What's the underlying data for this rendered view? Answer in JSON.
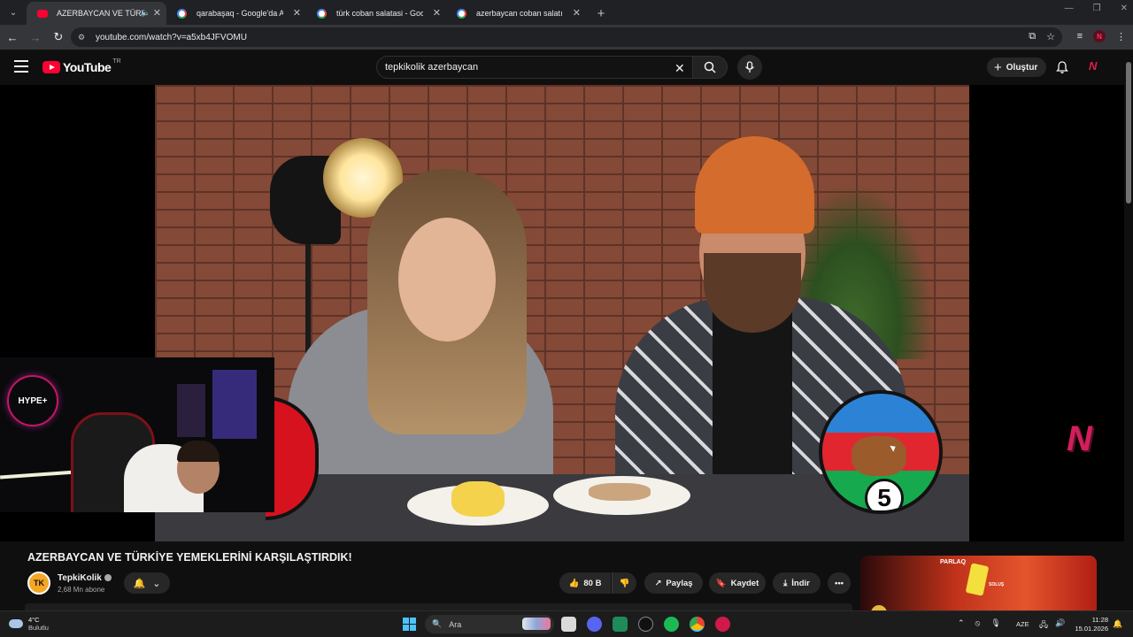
{
  "browser": {
    "tabs": [
      {
        "title": "AZERBAYCAN VE TÜRKİYE Y",
        "favicon": "youtube-icon",
        "active": true,
        "muted_icon": "speaker-icon"
      },
      {
        "title": "qarabaşaq - Google'da Ara",
        "favicon": "google-icon",
        "active": false
      },
      {
        "title": "türk coban salatasi - Google'da",
        "favicon": "google-icon",
        "active": false
      },
      {
        "title": "azerbaycan coban salatı - Goog",
        "favicon": "google-icon",
        "active": false
      }
    ],
    "new_tab_label": "+",
    "tab_close_label": "✕",
    "url": "youtube.com/watch?v=a5xb4JFVOMU"
  },
  "youtube": {
    "logo_text": "YouTube",
    "region": "TR",
    "search_value": "tepkikolik azerbaycan",
    "create_label": "Oluştur",
    "avatar_letter": "N"
  },
  "video": {
    "title": "AZERBAYCAN VE TÜRKİYE YEMEKLERİNİ KARŞILAŞTIRDIK!",
    "round_number": "5",
    "overlay_logo_text": "HYPE+",
    "watermark_letter": "N"
  },
  "channel": {
    "name": "TepkiKolik",
    "avatar_text": "TK",
    "subscribers": "2,68 Mn abone"
  },
  "actions": {
    "likes": "80 B",
    "share": "Paylaş",
    "save": "Kaydet",
    "download": "İndir",
    "more": "•••"
  },
  "ad": {
    "brand": "PARLAQ",
    "tagline": "SOLUŞ"
  },
  "taskbar": {
    "temperature": "4°C",
    "condition": "Bulutlu",
    "search_placeholder": "Ara",
    "language": "AZE",
    "time": "11:28",
    "date": "15.01.2026"
  }
}
